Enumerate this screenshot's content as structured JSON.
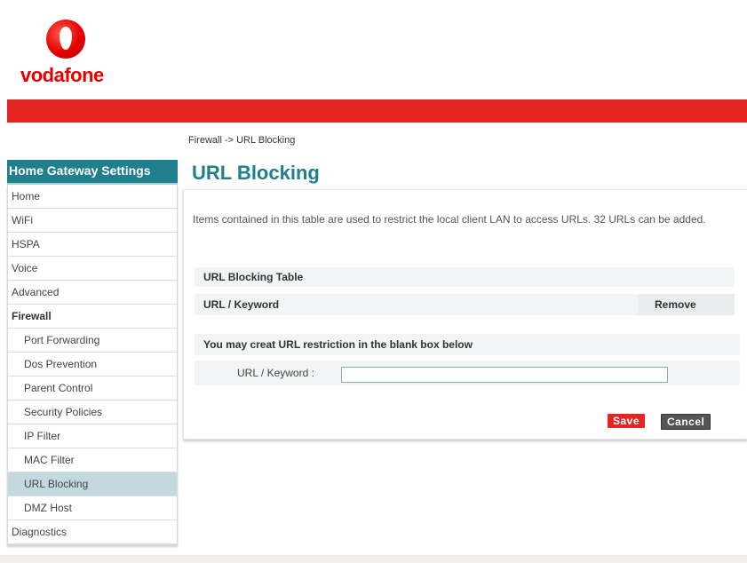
{
  "brand": {
    "logo_text": "vodafone"
  },
  "breadcrumb": "Firewall -> URL Blocking",
  "sidebar": {
    "header": "Home Gateway Settings",
    "items": [
      {
        "label": "Home"
      },
      {
        "label": "WiFi"
      },
      {
        "label": "HSPA"
      },
      {
        "label": "Voice"
      },
      {
        "label": "Advanced"
      },
      {
        "label": "Firewall"
      },
      {
        "label": "Port Forwarding"
      },
      {
        "label": "Dos Prevention"
      },
      {
        "label": "Parent Control"
      },
      {
        "label": "Security Policies"
      },
      {
        "label": "IP Filter"
      },
      {
        "label": "MAC Filter"
      },
      {
        "label": "URL Blocking"
      },
      {
        "label": "DMZ Host"
      },
      {
        "label": "Diagnostics"
      }
    ]
  },
  "main": {
    "title": "URL Blocking",
    "description": "Items contained in this table are used to restrict the local client LAN to access URLs. 32 URLs can be added.",
    "table": {
      "title": "URL Blocking Table",
      "col_keyword": "URL / Keyword",
      "col_remove": "Remove"
    },
    "form": {
      "heading": "You may creat URL restriction in the blank box below",
      "field_label": "URL / Keyword :",
      "field_value": ""
    },
    "buttons": {
      "save": "Save",
      "cancel": "Cancel"
    }
  },
  "colors": {
    "brand_red": "#e52521",
    "accent_teal": "#1f7f8d",
    "active_item": "#c3d9e0"
  }
}
